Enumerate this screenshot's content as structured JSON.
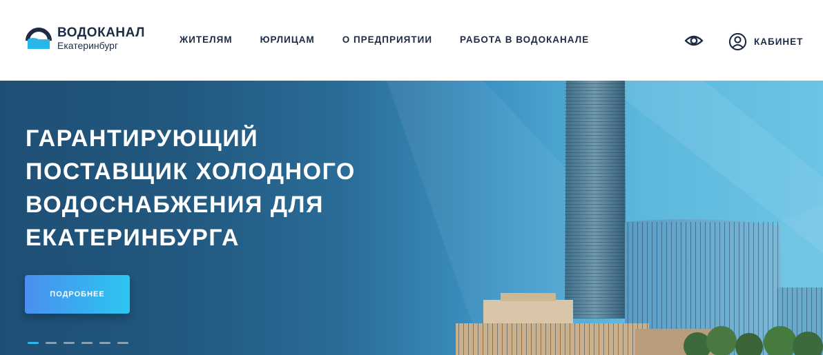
{
  "header": {
    "logo": {
      "title": "ВОДОКАНАЛ",
      "subtitle": "Екатеринбург",
      "mark_colors": {
        "ring": "#1d2b45",
        "water": "#29b6e8"
      }
    },
    "nav": [
      {
        "label": "ЖИТЕЛЯМ"
      },
      {
        "label": "ЮРЛИЦАМ"
      },
      {
        "label": "О ПРЕДПРИЯТИИ"
      },
      {
        "label": "РАБОТА В ВОДОКАНАЛЕ"
      }
    ],
    "accessibility_icon": "eye-icon",
    "cabinet": {
      "icon": "user-circle-icon",
      "label": "КАБИНЕТ"
    }
  },
  "hero": {
    "title_lines": [
      "ГАРАНТИРУЮЩИЙ",
      "ПОСТАВЩИК ХОЛОДНОГО",
      "ВОДОСНАБЖЕНИЯ ДЛЯ",
      "ЕКАТЕРИНБУРГА"
    ],
    "cta_label": "ПОДРОБНЕЕ",
    "slides_total": 6,
    "active_slide": 1
  },
  "colors": {
    "text_dark": "#1d2b45",
    "accent": "#2db7ea",
    "button_start": "#4a8ff0",
    "button_end": "#2cc6f0"
  }
}
